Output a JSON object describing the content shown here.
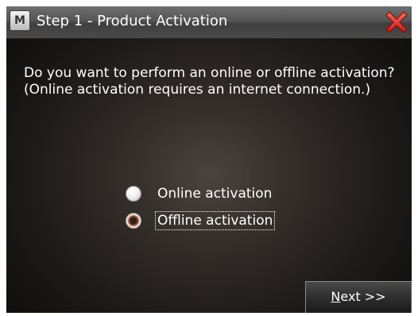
{
  "window": {
    "title": "Step 1 - Product Activation",
    "app_icon_letter": "M"
  },
  "question": "Do you want to perform an online or offline activation? (Online activation requires an internet connection.)",
  "options": [
    {
      "label": "Online activation",
      "checked": false
    },
    {
      "label": "Offline activation",
      "checked": true
    }
  ],
  "next_button": {
    "mnemonic": "N",
    "rest": "ext >>"
  },
  "colors": {
    "close_red": "#e02424",
    "selected_radio": "#8b4a32",
    "text": "#ffffff"
  },
  "icons": {
    "close": "close-x-icon",
    "app": "app-logo-icon"
  }
}
